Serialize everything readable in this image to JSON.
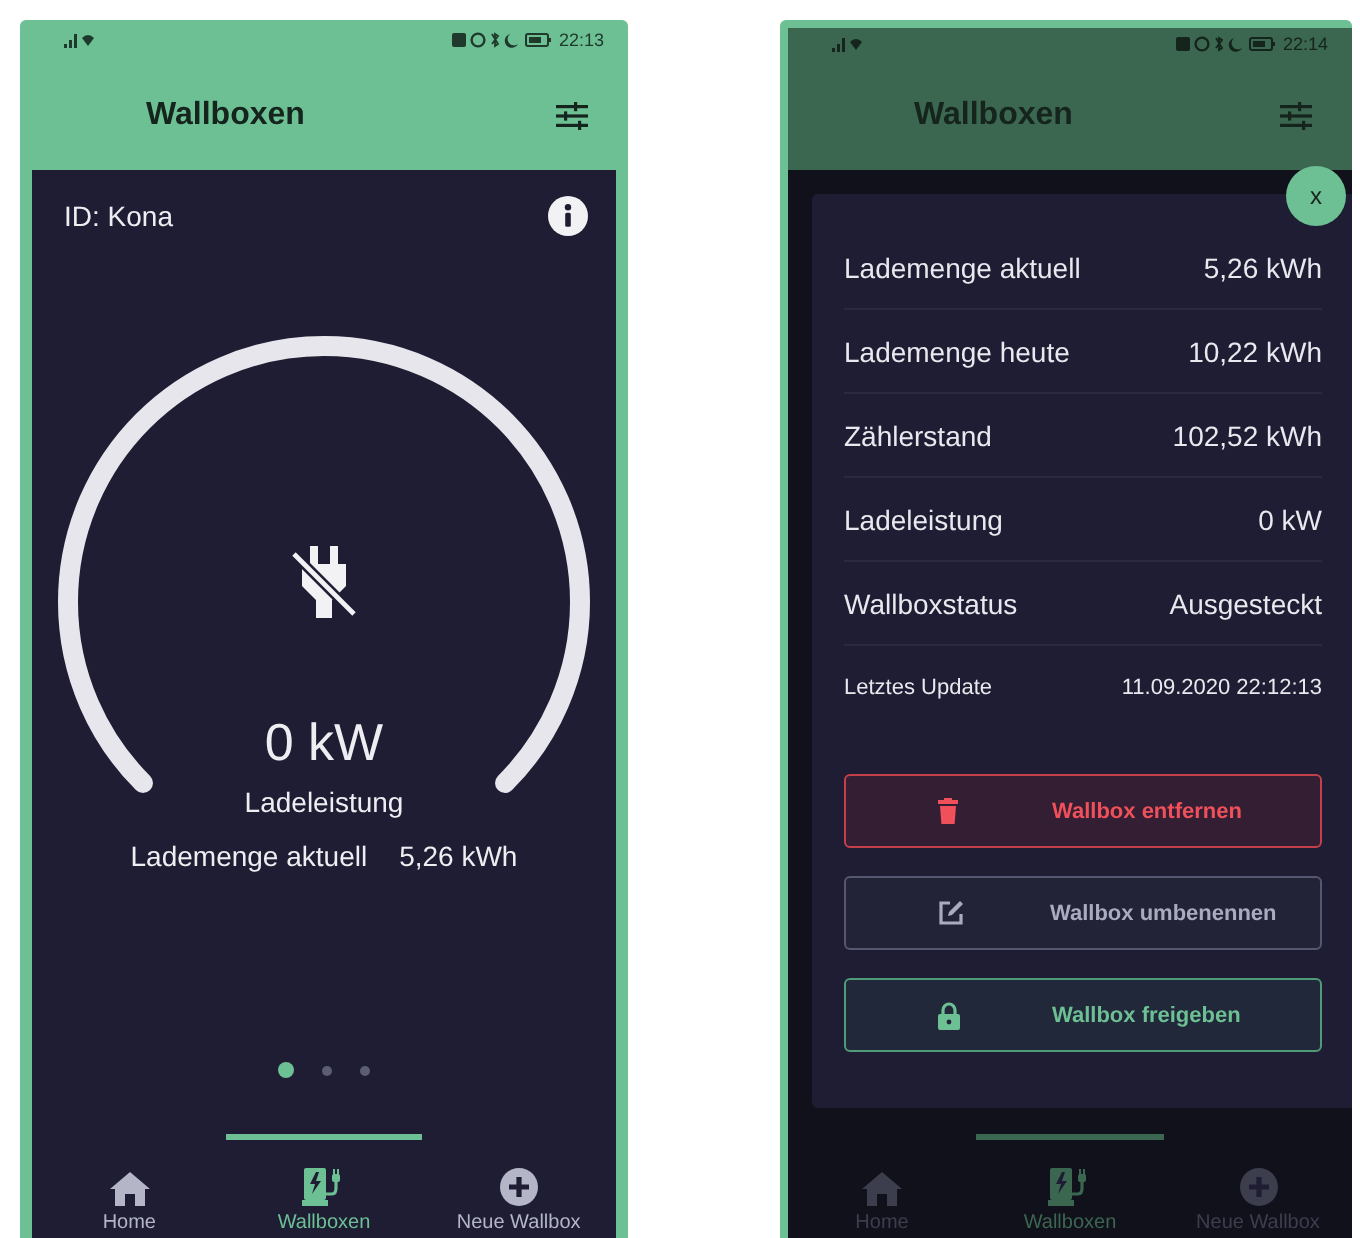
{
  "left_screen": {
    "status_bar": {
      "time": "22:13"
    },
    "header": {
      "title": "Wallboxen"
    },
    "id_label": "ID: Kona",
    "gauge": {
      "value": "0 kW",
      "label": "Ladeleistung",
      "plugged": false
    },
    "summary": {
      "label": "Lademenge aktuell",
      "value": "5,26 kWh"
    },
    "pager": [
      {
        "selected": true
      },
      {
        "selected": false
      },
      {
        "selected": false
      }
    ],
    "nav": [
      {
        "label": "Home",
        "kind": "home",
        "selected": false
      },
      {
        "label": "Wallboxen",
        "kind": "station",
        "selected": true
      },
      {
        "label": "Neue Wallbox",
        "kind": "add",
        "selected": false
      }
    ]
  },
  "right_screen": {
    "dimmed": true,
    "status_bar": {
      "time": "22:14"
    },
    "header": {
      "title": "Wallboxen"
    },
    "dialog": {
      "close": "x",
      "rows": [
        {
          "label": "Lademenge aktuell",
          "value": "5,26 kWh",
          "kind": "normal"
        },
        {
          "label": "Lademenge heute",
          "value": "10,22 kWh",
          "kind": "normal"
        },
        {
          "label": "Zählerstand",
          "value": "102,52 kWh",
          "kind": "normal"
        },
        {
          "label": "Ladeleistung",
          "value": "0 kW",
          "kind": "normal"
        },
        {
          "label": "Wallboxstatus",
          "value": "Ausgesteckt",
          "kind": "normal"
        },
        {
          "label": "Letztes Update",
          "value": "11.09.2020 22:12:13",
          "kind": "small"
        }
      ],
      "buttons": [
        {
          "label": "Wallbox entfernen",
          "kind": "danger"
        },
        {
          "label": "Wallbox umbenennen",
          "kind": "rename"
        },
        {
          "label": "Wallbox freigeben",
          "kind": "share"
        }
      ]
    },
    "nav": [
      {
        "label": "Home",
        "kind": "home",
        "selected": false
      },
      {
        "label": "Wallboxen",
        "kind": "station",
        "selected": true
      },
      {
        "label": "Neue Wallbox",
        "kind": "add",
        "selected": false
      }
    ]
  }
}
